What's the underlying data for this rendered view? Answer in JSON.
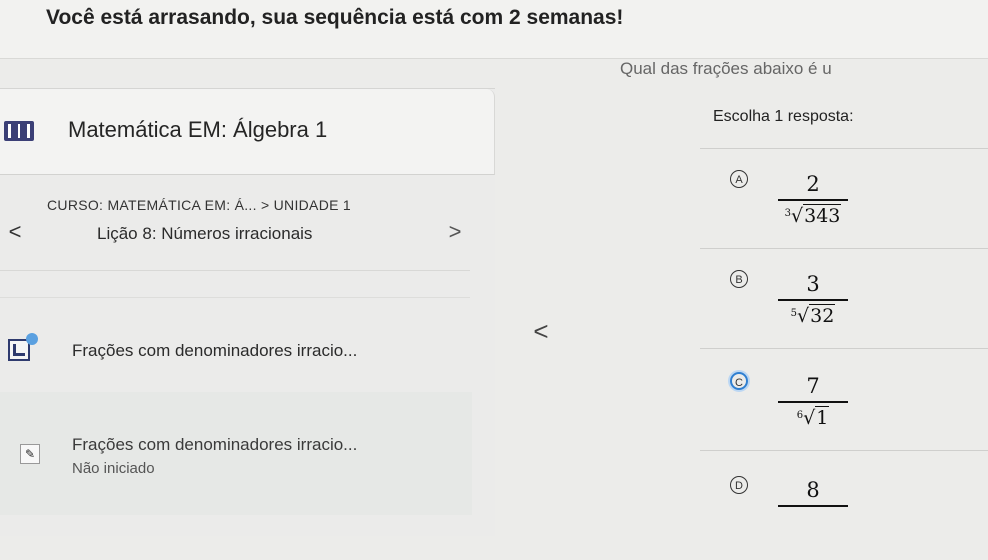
{
  "banner": {
    "text": "Você está arrasando, sua sequência está com 2 semanas!"
  },
  "question": {
    "top_text": "Qual das frações abaixo é u",
    "prompt": "Escolha 1 resposta:",
    "options": [
      {
        "letter": "A",
        "numerator": "2",
        "index": "3",
        "radicand": "343"
      },
      {
        "letter": "B",
        "numerator": "3",
        "index": "5",
        "radicand": "32"
      },
      {
        "letter": "C",
        "numerator": "7",
        "index": "6",
        "radicand": "1"
      },
      {
        "letter": "D",
        "numerator": "8",
        "index": "",
        "radicand": ""
      }
    ]
  },
  "course": {
    "title": "Matemática EM: Álgebra 1",
    "breadcrumb": "CURSO: MATEMÁTICA EM: Á... > UNIDADE 1",
    "lesson": "Lição 8: Números irracionais",
    "prev_glyph": "<",
    "next_glyph": ">"
  },
  "items": [
    {
      "label": "Frações com denominadores irracio..."
    },
    {
      "label": "Frações com denominadores irracio...",
      "status": "Não iniciado"
    }
  ],
  "icons": {
    "book": "book-icon",
    "exercise": "exercise-icon",
    "pencil": "pencil-icon",
    "pencil_glyph": "✎",
    "collapse_glyph": "<"
  }
}
